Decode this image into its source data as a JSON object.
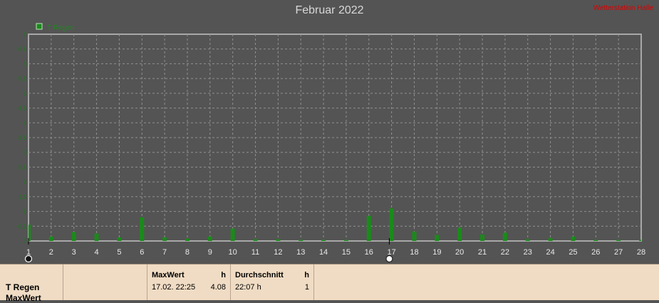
{
  "chart_title": "Februar 2022",
  "brand": "Wetterstation Halle",
  "legend": {
    "label": "T Regen",
    "color": "#1a8a1a"
  },
  "chart_data": {
    "type": "bar",
    "title": "Februar 2022",
    "x": [
      1,
      2,
      3,
      4,
      5,
      6,
      7,
      8,
      9,
      10,
      11,
      12,
      13,
      14,
      15,
      16,
      17,
      18,
      19,
      20,
      21,
      22,
      23,
      24,
      25,
      26,
      27,
      28
    ],
    "x_tick_labels": [
      "1",
      "2",
      "3",
      "4",
      "5",
      "6",
      "7",
      "8",
      "9",
      "10",
      "11",
      "12",
      "13",
      "14",
      "15",
      "16",
      "17",
      "18",
      "19",
      "20",
      "21",
      "22",
      "23",
      "24",
      "25",
      "26",
      "27",
      "28"
    ],
    "y_tick_labels": [
      "0",
      "0.5",
      "1",
      "1.5",
      "2",
      "2.5",
      "3",
      "3.5",
      "4",
      "4.5",
      "5",
      "5.5",
      "6",
      "6.5",
      "7"
    ],
    "ylim": [
      0,
      7
    ],
    "grid": true,
    "legend_position": "top-left",
    "series": [
      {
        "name": "T Regen",
        "color": "#1a8a1a",
        "values": [
          0.55,
          0.15,
          0.3,
          0.25,
          0.12,
          0.8,
          0.12,
          0.08,
          0.15,
          0.42,
          0.06,
          0.06,
          0.04,
          0.04,
          0.04,
          0.85,
          1.1,
          0.32,
          0.2,
          0.45,
          0.22,
          0.28,
          0.06,
          0.1,
          0.15,
          0.04,
          0.04,
          0.04
        ]
      }
    ]
  },
  "moon_phases": [
    {
      "day": 1,
      "phase": "new-moon"
    },
    {
      "day": 16.9,
      "phase": "full-moon"
    }
  ],
  "table": {
    "row_label": "T Regen",
    "row_label2": "MaxWert",
    "columns": [
      {
        "header": "MaxWert",
        "unit": "h",
        "value_left": "17.02.  22:25",
        "value_right": "4.08"
      },
      {
        "header": "Durchschnitt",
        "unit": "h",
        "value_left": "22:07 h",
        "value_right": "1"
      }
    ]
  }
}
